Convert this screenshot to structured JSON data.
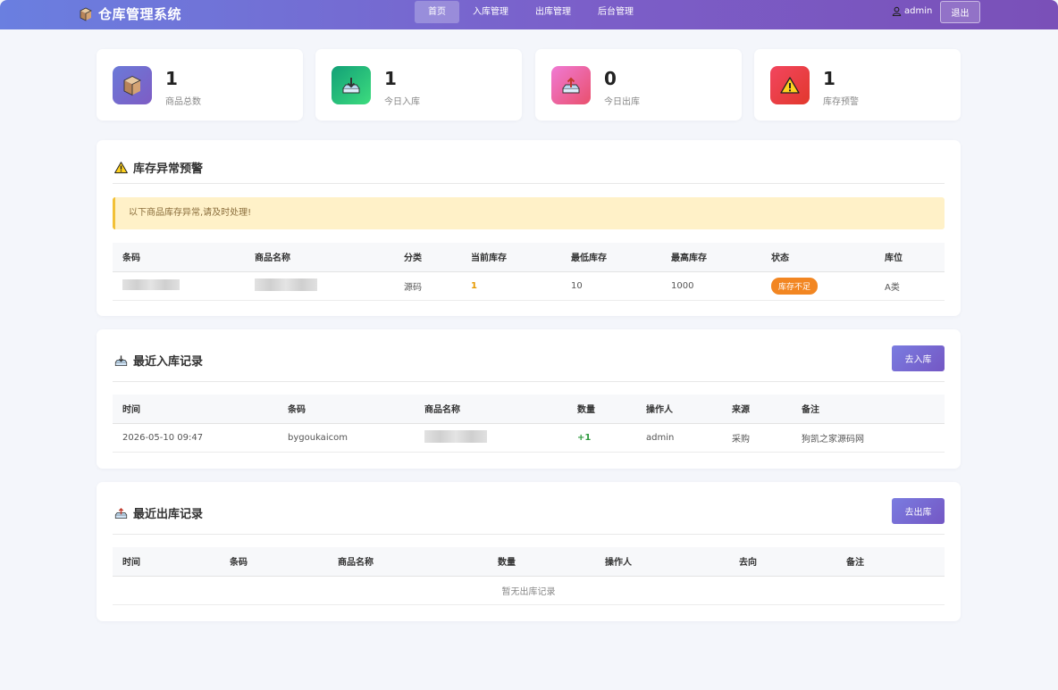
{
  "header": {
    "brand": "仓库管理系统",
    "nav": [
      "首页",
      "入库管理",
      "出库管理",
      "后台管理"
    ],
    "active_nav": "首页",
    "user": "admin",
    "logout": "退出"
  },
  "stats": [
    {
      "value": "1",
      "label": "商品总数",
      "icon": "box-icon",
      "color": "#7b66cc"
    },
    {
      "value": "1",
      "label": "今日入库",
      "icon": "inbox-in-icon",
      "color": "#22b573"
    },
    {
      "value": "0",
      "label": "今日出库",
      "icon": "outbox-icon",
      "color": "#e85e9a"
    },
    {
      "value": "1",
      "label": "库存预警",
      "icon": "warning-icon",
      "color": "#e9403f"
    }
  ],
  "warning_section": {
    "title": "库存异常预警",
    "alert": "以下商品库存异常,请及时处理!",
    "columns": [
      "条码",
      "商品名称",
      "分类",
      "当前库存",
      "最低库存",
      "最高库存",
      "状态",
      "库位"
    ],
    "rows": [
      {
        "category": "源码",
        "current": "1",
        "min": "10",
        "max": "1000",
        "status": "库存不足",
        "location": "A类"
      }
    ]
  },
  "inbound_section": {
    "title": "最近入库记录",
    "button": "去入库",
    "columns": [
      "时间",
      "条码",
      "商品名称",
      "数量",
      "操作人",
      "来源",
      "备注"
    ],
    "rows": [
      {
        "time": "2026-05-10 09:47",
        "barcode": "bygoukaicom",
        "qty": "+1",
        "operator": "admin",
        "source": "采购",
        "note": "狗凯之家源码网"
      }
    ]
  },
  "outbound_section": {
    "title": "最近出库记录",
    "button": "去出库",
    "columns": [
      "时间",
      "条码",
      "商品名称",
      "数量",
      "操作人",
      "去向",
      "备注"
    ],
    "empty": "暂无出库记录"
  },
  "colors": {
    "accent": "#7457c4",
    "warning": "#f28622",
    "success": "#2e9a3e"
  }
}
